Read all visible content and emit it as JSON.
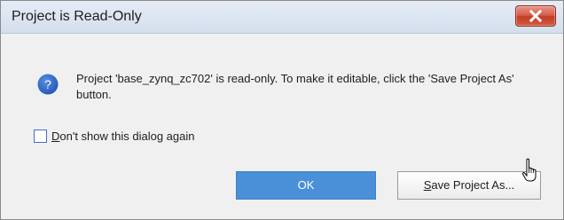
{
  "dialog": {
    "title": "Project is Read-Only",
    "message": "Project 'base_zynq_zc702' is read-only. To make it editable, click the 'Save Project As' button.",
    "checkbox": {
      "mnemonic": "D",
      "label_rest": "on't show this dialog again",
      "checked": false
    },
    "buttons": {
      "ok_label": "OK",
      "save_mnemonic": "S",
      "save_label_rest": "ave Project As..."
    },
    "icons": {
      "close": "close-icon",
      "info": "question-icon",
      "cursor": "hand-pointer-icon"
    },
    "colors": {
      "accent": "#4a90d9",
      "close_red": "#c9442f",
      "info_blue": "#2a66c7"
    }
  }
}
